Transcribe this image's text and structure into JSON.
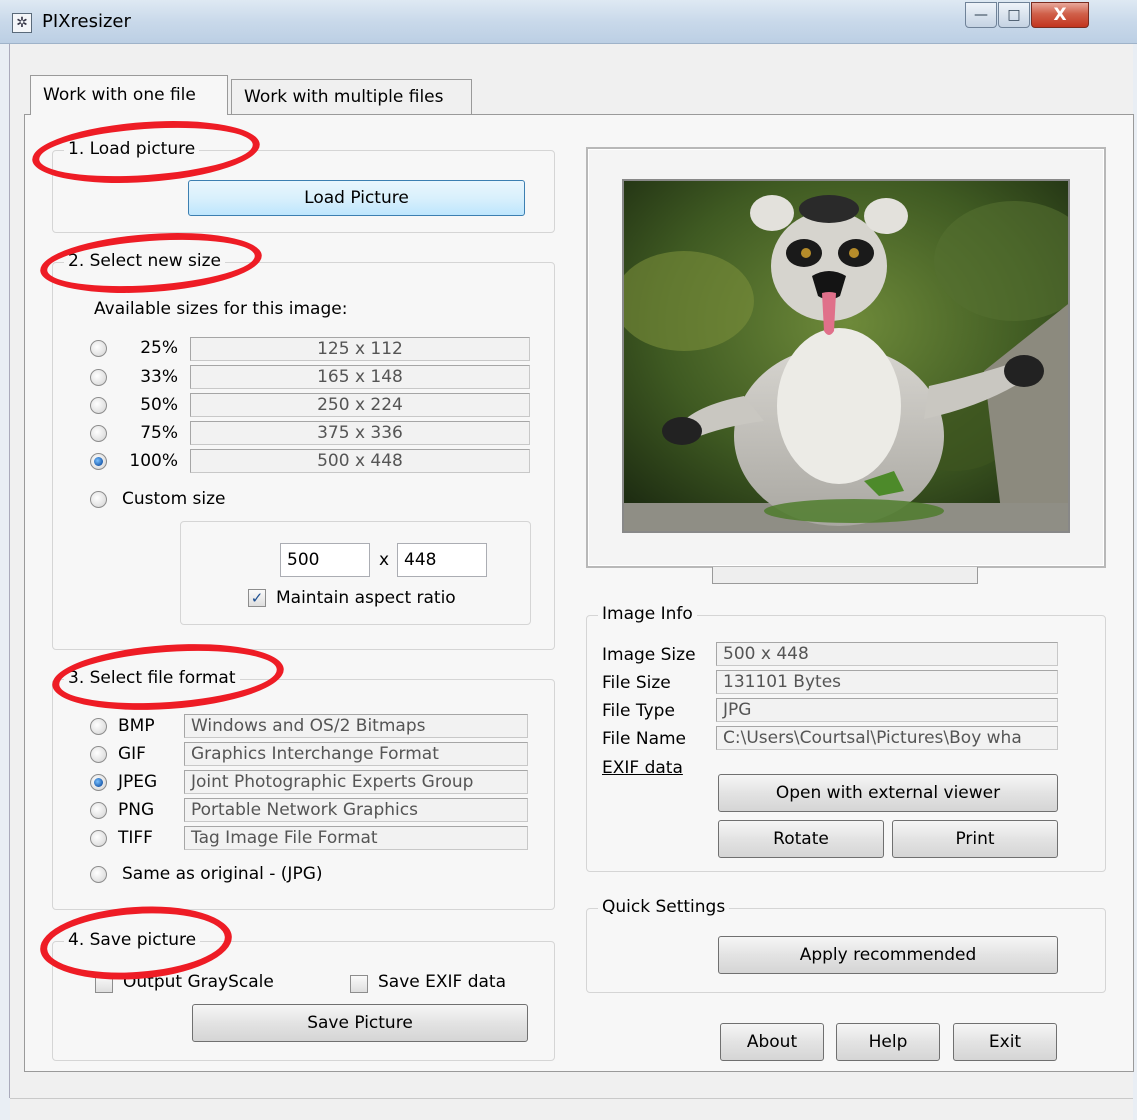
{
  "window": {
    "title": "PIXresizer",
    "minimize": "—",
    "maximize": "□",
    "close": "X"
  },
  "tabs": [
    {
      "label": "Work with one file",
      "active": true
    },
    {
      "label": "Work with multiple files",
      "active": false
    }
  ],
  "load": {
    "legend": "1. Load picture",
    "button": "Load Picture"
  },
  "size": {
    "legend": "2. Select new size",
    "available_label": "Available sizes for this image:",
    "options": [
      {
        "percent": "25%",
        "dims": "125 x 112",
        "selected": false
      },
      {
        "percent": "33%",
        "dims": "165 x 148",
        "selected": false
      },
      {
        "percent": "50%",
        "dims": "250 x 224",
        "selected": false
      },
      {
        "percent": "75%",
        "dims": "375 x 336",
        "selected": false
      },
      {
        "percent": "100%",
        "dims": "500 x 448",
        "selected": true
      }
    ],
    "custom_label": "Custom size",
    "width": "500",
    "times": "x",
    "height": "448",
    "aspect_label": "Maintain aspect ratio",
    "aspect_checked": true
  },
  "format": {
    "legend": "3. Select file format",
    "options": [
      {
        "code": "BMP",
        "desc": "Windows and OS/2 Bitmaps",
        "selected": false
      },
      {
        "code": "GIF",
        "desc": "Graphics Interchange Format",
        "selected": false
      },
      {
        "code": "JPEG",
        "desc": "Joint Photographic Experts Group",
        "selected": true
      },
      {
        "code": "PNG",
        "desc": "Portable Network Graphics",
        "selected": false
      },
      {
        "code": "TIFF",
        "desc": "Tag Image File Format",
        "selected": false
      }
    ],
    "same_label": "Same as original  - (JPG)"
  },
  "save": {
    "legend": "4. Save picture",
    "grayscale_label": "Output GrayScale",
    "exif_label": "Save EXIF data",
    "button": "Save Picture"
  },
  "info": {
    "legend": "Image Info",
    "rows": [
      {
        "label": "Image Size",
        "value": "500 x 448"
      },
      {
        "label": "File Size",
        "value": "131101 Bytes"
      },
      {
        "label": "File Type",
        "value": "JPG"
      },
      {
        "label": "File Name",
        "value": "C:\\Users\\Courtsal\\Pictures\\Boy wha"
      }
    ],
    "exif_link": "EXIF data",
    "open_external": "Open with external viewer",
    "rotate": "Rotate",
    "print": "Print"
  },
  "quick": {
    "legend": "Quick Settings",
    "apply": "Apply recommended"
  },
  "footer": {
    "about": "About",
    "help": "Help",
    "exit": "Exit"
  },
  "colors": {
    "highlight_ring": "#ee1c25",
    "focus_button": "#3c7fb1",
    "radio_selected": "#1f5fb0"
  }
}
